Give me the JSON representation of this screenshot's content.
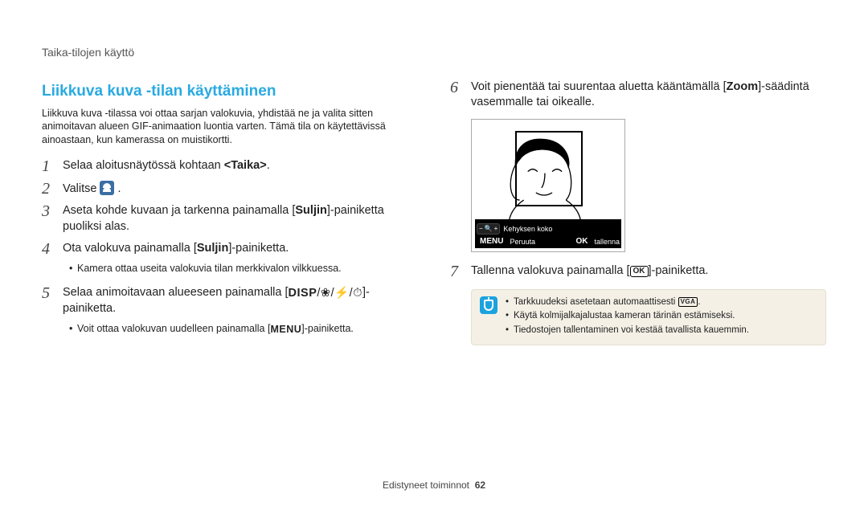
{
  "breadcrumb": "Taika-tilojen käyttö",
  "section_title": "Liikkuva kuva -tilan käyttäminen",
  "intro": "Liikkuva kuva -tilassa voi ottaa sarjan valokuvia, yhdistää ne ja valita sitten animoitavan alueen GIF-animaation luontia varten. Tämä tila on käytettävissä ainoastaan, kun kamerassa on muistikortti.",
  "steps_left": {
    "s1_pre": "Selaa aloitusnäytössä kohtaan ",
    "s1_tag": "<Taika>",
    "s1_post": ".",
    "s2_pre": "Valitse ",
    "s2_post": " .",
    "s3_pre": "Aseta kohde kuvaan ja tarkenna painamalla [",
    "s3_bold": "Suljin",
    "s3_post": "]-painiketta puoliksi alas.",
    "s4_pre": "Ota valokuva painamalla [",
    "s4_bold": "Suljin",
    "s4_post": "]-painiketta.",
    "s4_sub1": "Kamera ottaa useita valokuvia tilan merkkivalon vilkkuessa.",
    "s5_pre": "Selaa animoitavaan alueeseen painamalla [",
    "s5_glyph_disp": "DISP",
    "s5_post": "]-painiketta.",
    "s5_sub1_pre": "Voit ottaa valokuvan uudelleen painamalla [",
    "s5_sub1_glyph": "MENU",
    "s5_sub1_post": "]-painiketta."
  },
  "steps_right": {
    "s6_pre": "Voit pienentää tai suurentaa aluetta kääntämällä [",
    "s6_bold": "Zoom",
    "s6_post": "]-säädintä vasemmalle tai oikealle.",
    "s7_pre": "Tallenna valokuva painamalla [",
    "s7_glyph": "OK",
    "s7_post": "]-painiketta."
  },
  "camera_overlay": {
    "frame_label": "Kehyksen koko",
    "menu_label": "MENU",
    "cancel_label": "Peruuta",
    "ok_label": "OK",
    "save_label": "tallenna"
  },
  "tip": {
    "t1_pre": "Tarkkuudeksi asetetaan automaattisesti ",
    "t1_badge": "VGA",
    "t1_post": ".",
    "t2": "Käytä kolmijalkajalustaa kameran tärinän estämiseksi.",
    "t3": "Tiedostojen tallentaminen voi kestää tavallista kauemmin."
  },
  "footer": {
    "label": "Edistyneet toiminnot",
    "page": "62"
  },
  "chart_data": null
}
